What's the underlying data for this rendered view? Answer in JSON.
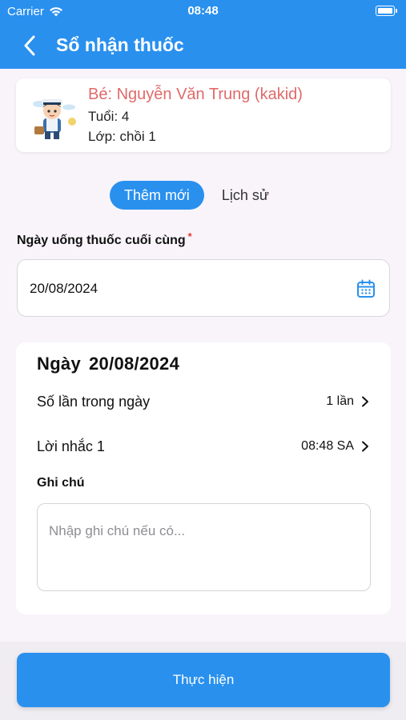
{
  "status_bar": {
    "carrier": "Carrier",
    "time": "08:48"
  },
  "nav": {
    "title": "Sổ nhận thuốc",
    "back_icon": "chevron-left-icon"
  },
  "child": {
    "name": "Bé: Nguyễn Văn Trung (kakid)",
    "age": "Tuổi: 4",
    "class": "Lớp: chồi 1",
    "name_color": "#e06a6a"
  },
  "tabs": [
    {
      "label": "Thêm mới",
      "active": true
    },
    {
      "label": "Lịch sử",
      "active": false
    }
  ],
  "last_dose": {
    "label": "Ngày uống thuốc cuối cùng",
    "required_mark": "*",
    "value": "20/08/2024",
    "icon": "calendar-icon"
  },
  "day_card": {
    "title_prefix": "Ngày",
    "date": "20/08/2024",
    "times_label": "Số lần trong ngày",
    "times_value": "1 lần",
    "reminder_label": "Lời nhắc 1",
    "reminder_value": "08:48 SA",
    "note_label": "Ghi chú",
    "note_placeholder": "Nhập ghi chú nếu có..."
  },
  "submit": {
    "label": "Thực hiện"
  },
  "colors": {
    "primary": "#2990ee",
    "background": "#f8f4fa",
    "required": "#e53935"
  }
}
